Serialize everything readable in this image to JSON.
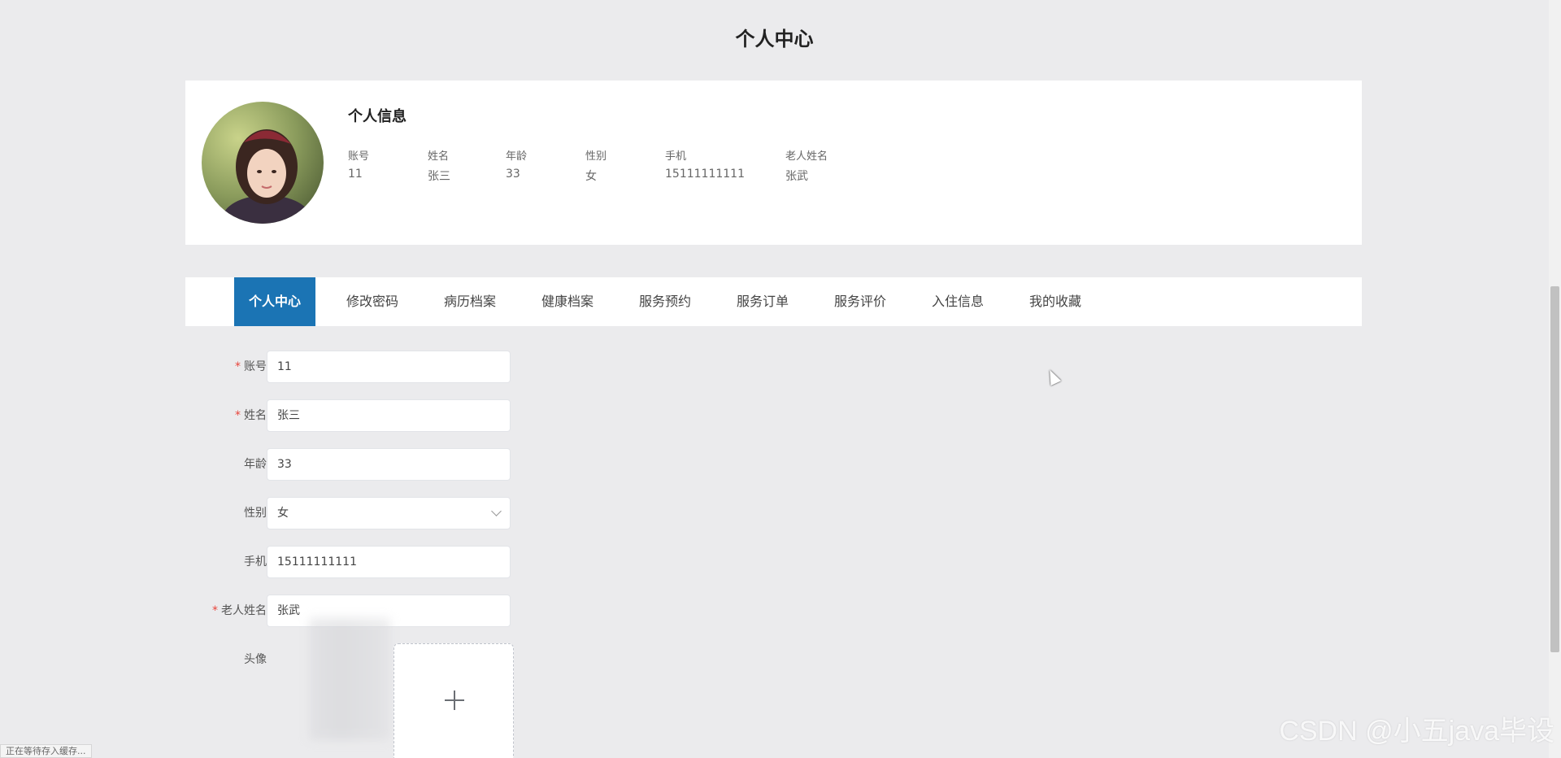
{
  "page": {
    "title": "个人中心"
  },
  "profile": {
    "heading": "个人信息",
    "fields": [
      {
        "label": "账号",
        "value": "11"
      },
      {
        "label": "姓名",
        "value": "张三"
      },
      {
        "label": "年龄",
        "value": "33"
      },
      {
        "label": "性别",
        "value": "女"
      },
      {
        "label": "手机",
        "value": "15111111111"
      },
      {
        "label": "老人姓名",
        "value": "张武"
      }
    ]
  },
  "tabs": [
    {
      "label": "个人中心",
      "active": true
    },
    {
      "label": "修改密码"
    },
    {
      "label": "病历档案"
    },
    {
      "label": "健康档案"
    },
    {
      "label": "服务预约"
    },
    {
      "label": "服务订单"
    },
    {
      "label": "服务评价"
    },
    {
      "label": "入住信息"
    },
    {
      "label": "我的收藏"
    }
  ],
  "form": {
    "account": {
      "label": "账号",
      "required": "*",
      "value": "11"
    },
    "name": {
      "label": "姓名",
      "required": "*",
      "value": "张三"
    },
    "age": {
      "label": "年龄",
      "value": "33"
    },
    "gender": {
      "label": "性别",
      "value": "女"
    },
    "phone": {
      "label": "手机",
      "value": "15111111111"
    },
    "elder_name": {
      "label": "老人姓名",
      "required": "*",
      "value": "张武"
    },
    "avatar": {
      "label": "头像"
    }
  },
  "status_bar": "正在等待存入缓存...",
  "watermark": "CSDN @小五java毕设",
  "colors": {
    "accent": "#1b74b4",
    "required": "#e8443b",
    "background": "#ebebed"
  }
}
